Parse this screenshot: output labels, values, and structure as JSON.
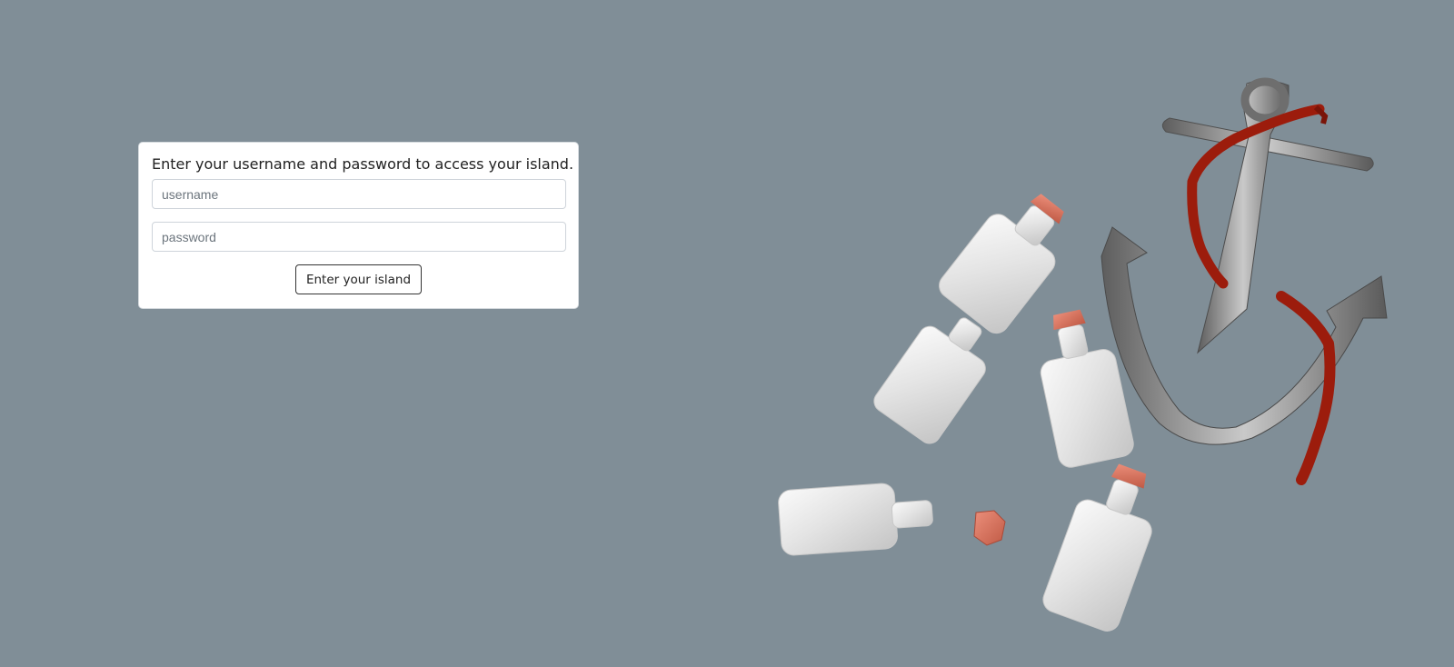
{
  "login": {
    "heading": "Enter your username and password to access your island.",
    "username": {
      "value": "",
      "placeholder": "username"
    },
    "password": {
      "value": "",
      "placeholder": "password"
    },
    "submit_label": "Enter your island"
  },
  "scene": {
    "colors": {
      "background": "#808e97",
      "bottle_glass": "#e3e3e3",
      "cork": "#d9735e",
      "anchor_metal": "#8a8a8a",
      "rope": "#9c1c0c"
    },
    "objects": [
      "anchor",
      "rope",
      "bottle",
      "bottle",
      "bottle",
      "bottle",
      "bottle",
      "cork"
    ]
  }
}
